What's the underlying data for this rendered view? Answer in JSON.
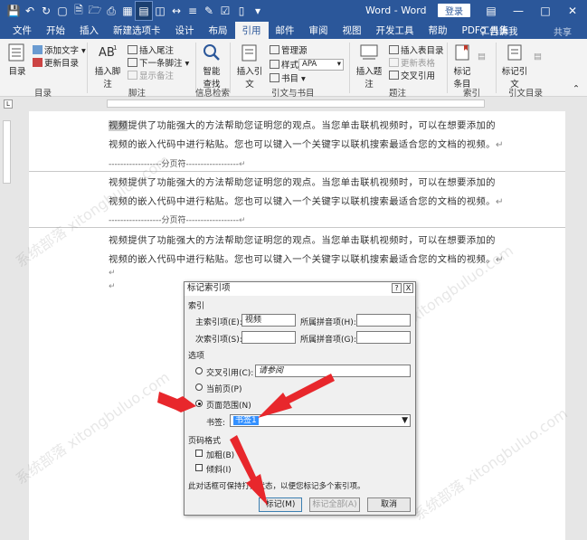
{
  "titlebar": {
    "title": "Word - Word",
    "login": "登录"
  },
  "tabs": [
    "文件",
    "开始",
    "插入",
    "新建选项卡",
    "设计",
    "布局",
    "引用",
    "邮件",
    "审阅",
    "视图",
    "开发工具",
    "帮助",
    "PDF工具集"
  ],
  "active_tab": "引用",
  "tell_me": "告诉我",
  "share": "共享",
  "ribbon": {
    "toc": {
      "big": "目录",
      "add_text": "添加文字",
      "update": "更新目录",
      "group": "目录"
    },
    "footnotes": {
      "insert_footnote": "插入脚注",
      "insert_endnote": "插入尾注",
      "next_footnote": "下一条脚注",
      "show_notes": "显示备注",
      "group": "脚注"
    },
    "research": {
      "smart_lookup": "智能查找",
      "group": "信息检索"
    },
    "citations": {
      "insert_citation": "插入引文",
      "manage_sources": "管理源",
      "style_label": "样式:",
      "style_value": "APA",
      "bibliography": "书目",
      "group": "引文与书目"
    },
    "captions": {
      "insert_caption": "插入题注",
      "insert_table_of_figures": "插入表目录",
      "update_table": "更新表格",
      "cross_reference": "交叉引用",
      "group": "题注"
    },
    "index": {
      "mark_entry": "标记条目",
      "group": "索引"
    },
    "authorities": {
      "mark_citation": "标记引文",
      "group": "引文目录"
    }
  },
  "document": {
    "paragraph_line1": "视频提供了功能强大的方法帮助您证明您的观点。当您单击联机视频时，可以在想要添加的",
    "paragraph_line2": "视频的嵌入代码中进行粘贴。您也可以键入一个关键字以联机搜索最适合您的文档的视频。",
    "page_break": "分页符",
    "paragraph_mark": "↵"
  },
  "dialog": {
    "title": "标记索引项",
    "help": "?",
    "close": "X",
    "section_index": "索引",
    "main_entry_label": "主索引项(E):",
    "main_entry_value": "视频",
    "main_pinyin_label": "所属拼音项(H):",
    "sub_entry_label": "次索引项(S):",
    "sub_pinyin_label": "所属拼音项(G):",
    "section_options": "选项",
    "cross_ref_label": "交叉引用(C):",
    "cross_ref_value": "请参阅",
    "current_page_label": "当前页(P)",
    "page_range_label": "页面范围(N)",
    "bookmark_label": "书签:",
    "bookmark_value": "书签1",
    "selected_option": "页面范围(N)",
    "section_page_format": "页码格式",
    "bold_label": "加粗(B)",
    "italic_label": "倾斜(I)",
    "note": "此对话框可保持打开状态，以便您标记多个索引项。",
    "mark_button": "标记(M)",
    "mark_all_button": "标记全部(A)",
    "cancel_button": "取消"
  },
  "colors": {
    "word_blue": "#2b579a",
    "arrow_red": "#e8272c"
  }
}
